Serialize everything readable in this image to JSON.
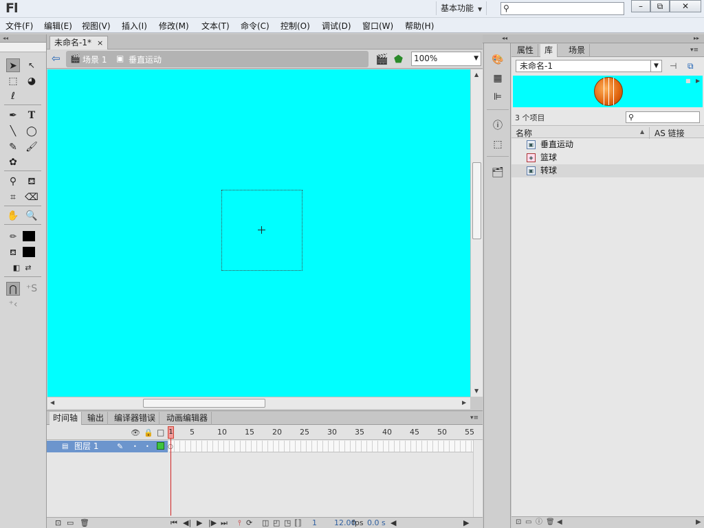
{
  "app": {
    "logo": "Fl",
    "workspace": "基本功能"
  },
  "window_buttons": {
    "minimize": "–",
    "restore": "⧉",
    "close": "✕"
  },
  "menu": [
    "文件(F)",
    "编辑(E)",
    "视图(V)",
    "插入(I)",
    "修改(M)",
    "文本(T)",
    "命令(C)",
    "控制(O)",
    "调试(D)",
    "窗口(W)",
    "帮助(H)"
  ],
  "document": {
    "tab_title": "未命名-1*",
    "tab_close": "×",
    "breadcrumb": {
      "scene": "场景 1",
      "symbol": "垂直运动"
    },
    "zoom": "100%"
  },
  "timeline": {
    "tabs": [
      "时间轴",
      "输出",
      "编译器错误",
      "动画编辑器"
    ],
    "frame_labels": [
      "1",
      "5",
      "10",
      "15",
      "20",
      "25",
      "30",
      "35",
      "40",
      "45",
      "50",
      "55"
    ],
    "layer_name": "图层 1",
    "current_frame": "1",
    "fps_value": "12.00",
    "fps_unit": "fps",
    "elapsed": "0.0 s"
  },
  "library": {
    "tabs": [
      "属性",
      "库",
      "场景"
    ],
    "active_tab": "库",
    "document_select": "未命名-1",
    "item_count": "3 个项目",
    "column_name": "名称",
    "column_as": "AS 链接",
    "items": [
      {
        "name": "垂直运动",
        "icon": "movieclip-icon"
      },
      {
        "name": "篮球",
        "icon": "graphic-icon"
      },
      {
        "name": "转球",
        "icon": "movieclip-icon"
      }
    ],
    "selected_item": "转球"
  },
  "colors": {
    "stage": "#00ffff",
    "layer_highlight": "#6c95cd",
    "playhead": "#d02020",
    "ball": "#e0640e"
  }
}
